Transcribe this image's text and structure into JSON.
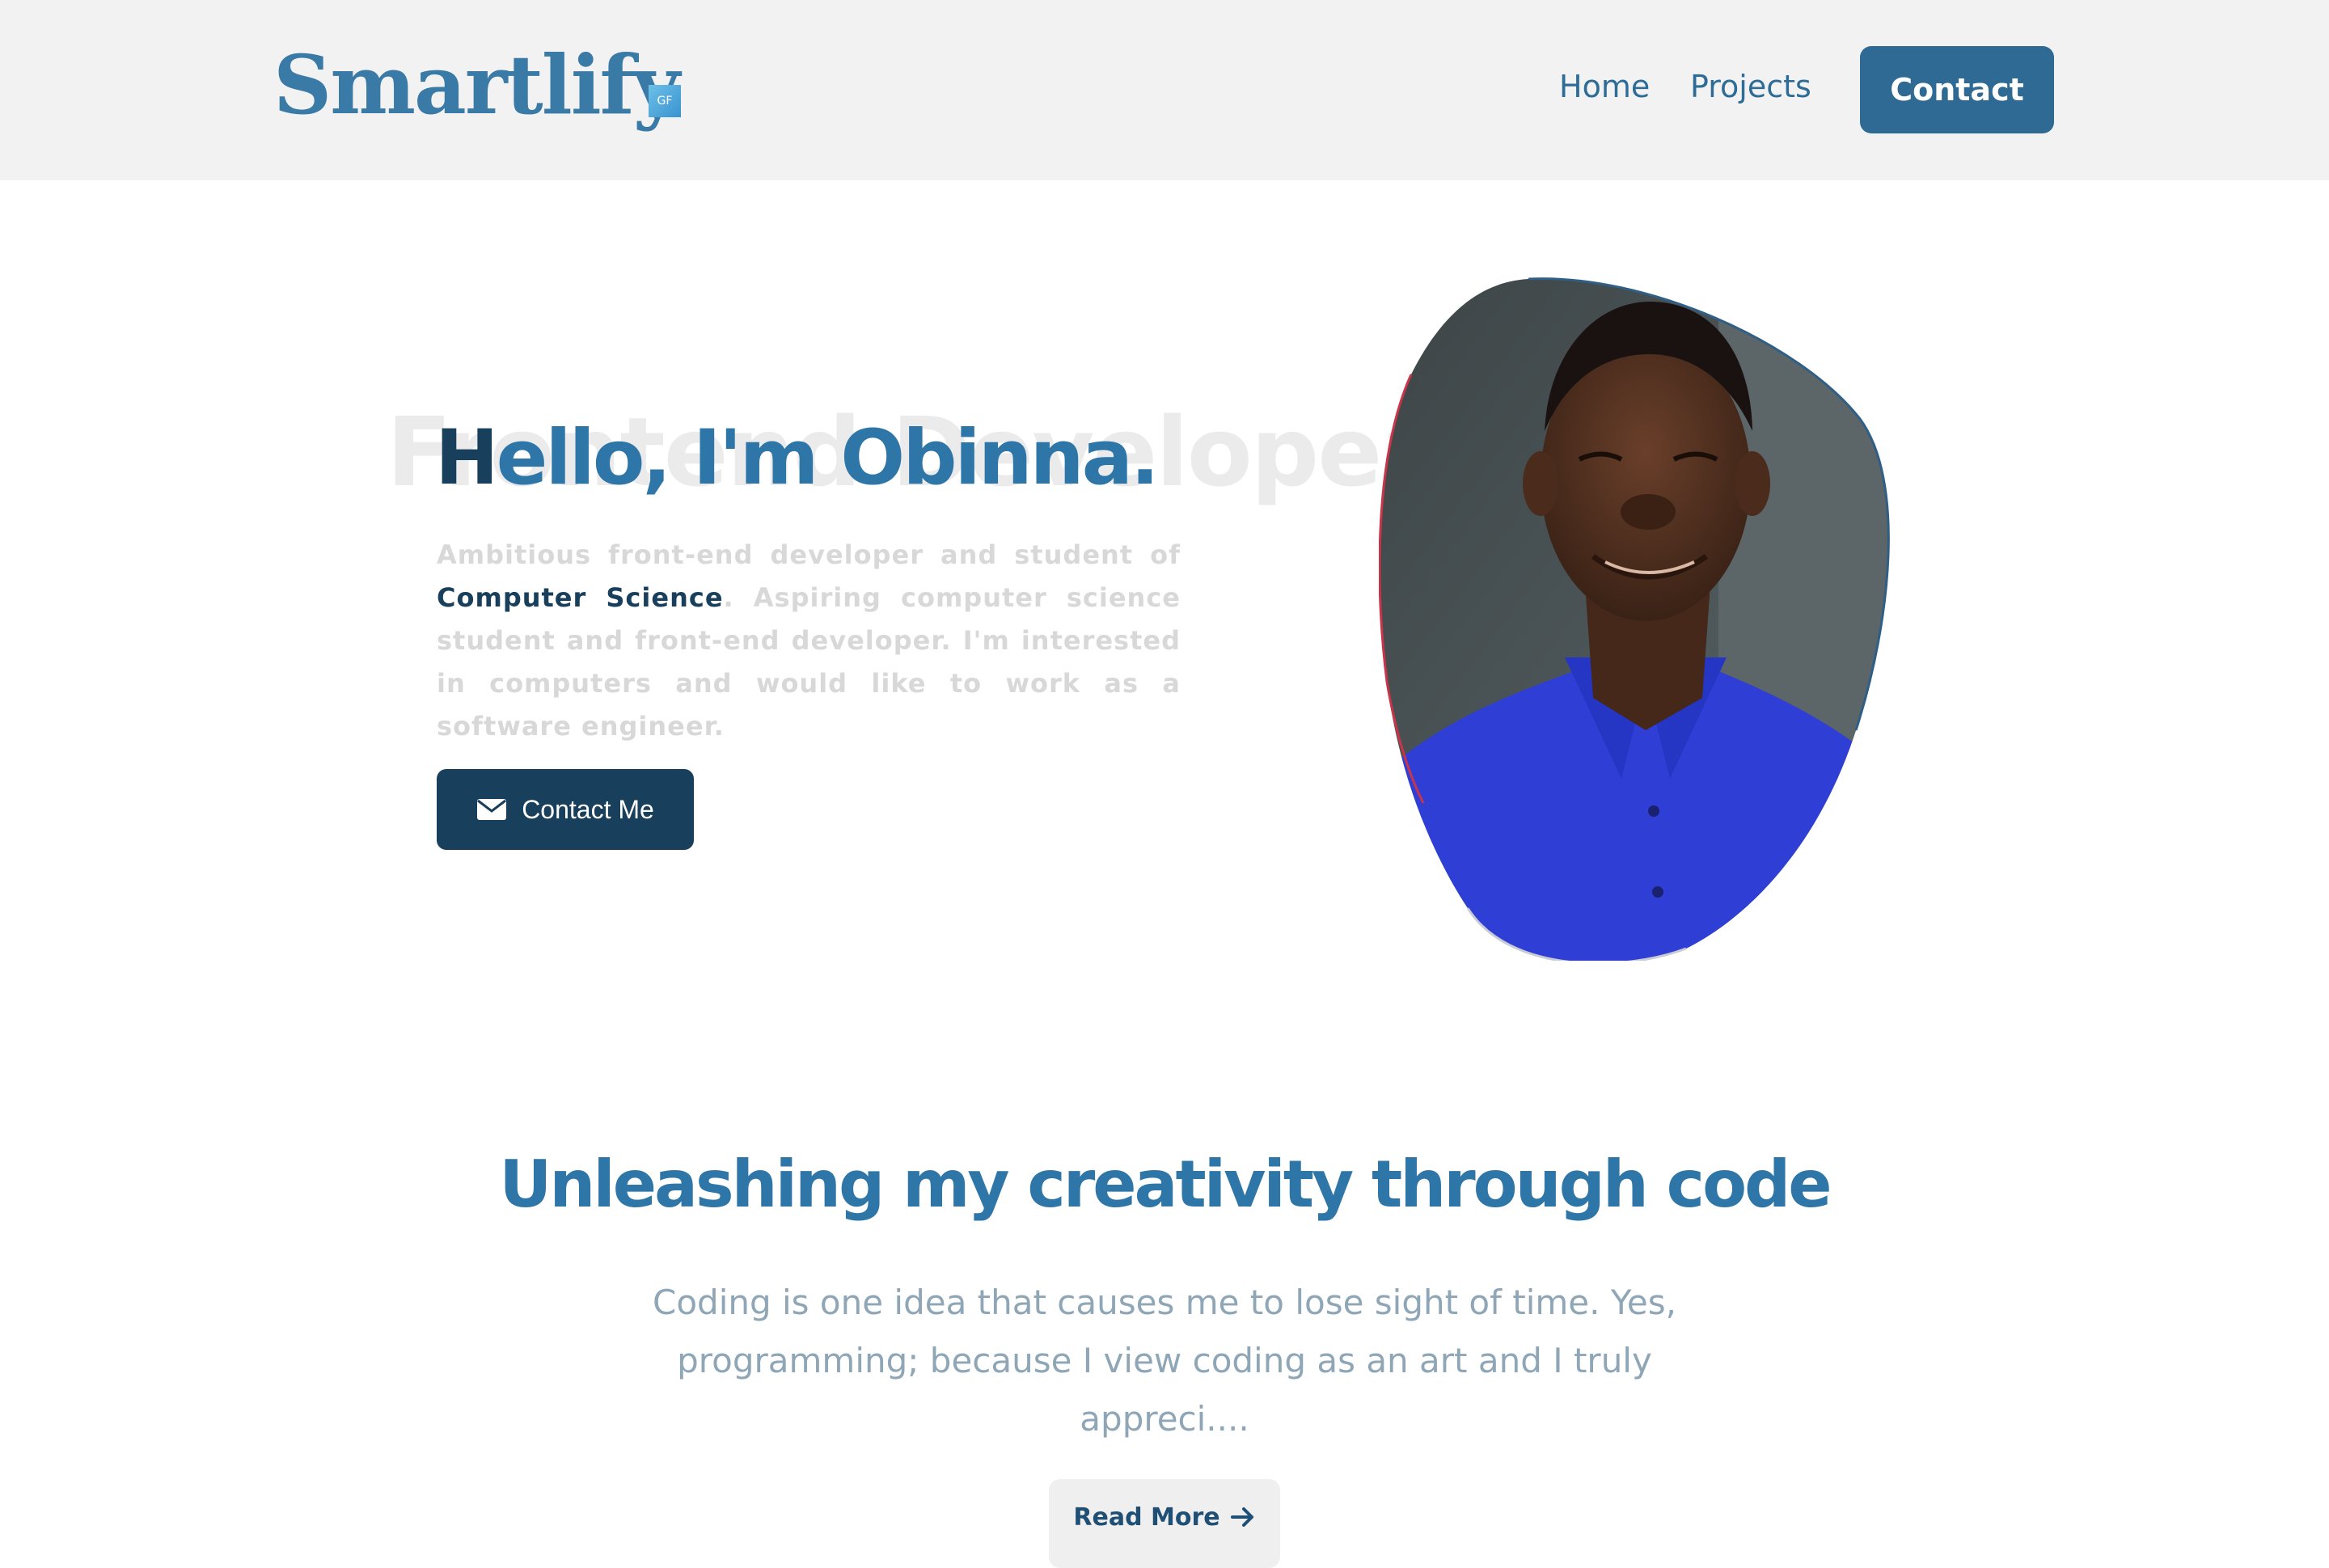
{
  "header": {
    "logo": "Smartlify",
    "logo_badge": "GF",
    "nav": {
      "home": "Home",
      "projects": "Projects",
      "contact": "Contact"
    }
  },
  "hero": {
    "bg_text": "Frontend Developer",
    "title_first": "H",
    "title_rest": "ello, I'm Obinna.",
    "desc_part1": "Ambitious front-end developer and student of ",
    "desc_highlight": "Computer Science",
    "desc_part2": ". Aspiring computer science student and front-end developer. I'm interested in computers and would like to work as a software engineer.",
    "contact_button": "Contact Me"
  },
  "about": {
    "title": "Unleashing my creativity through code",
    "text": "Coding is one idea that causes me to lose sight of time. Yes, programming; because I view coding as an art and I truly appreci....",
    "read_more": "Read More"
  },
  "colors": {
    "primary": "#2f76a8",
    "dark": "#183f5c",
    "header_bg": "#f2f2f2",
    "muted_text": "#8fa6b7"
  }
}
